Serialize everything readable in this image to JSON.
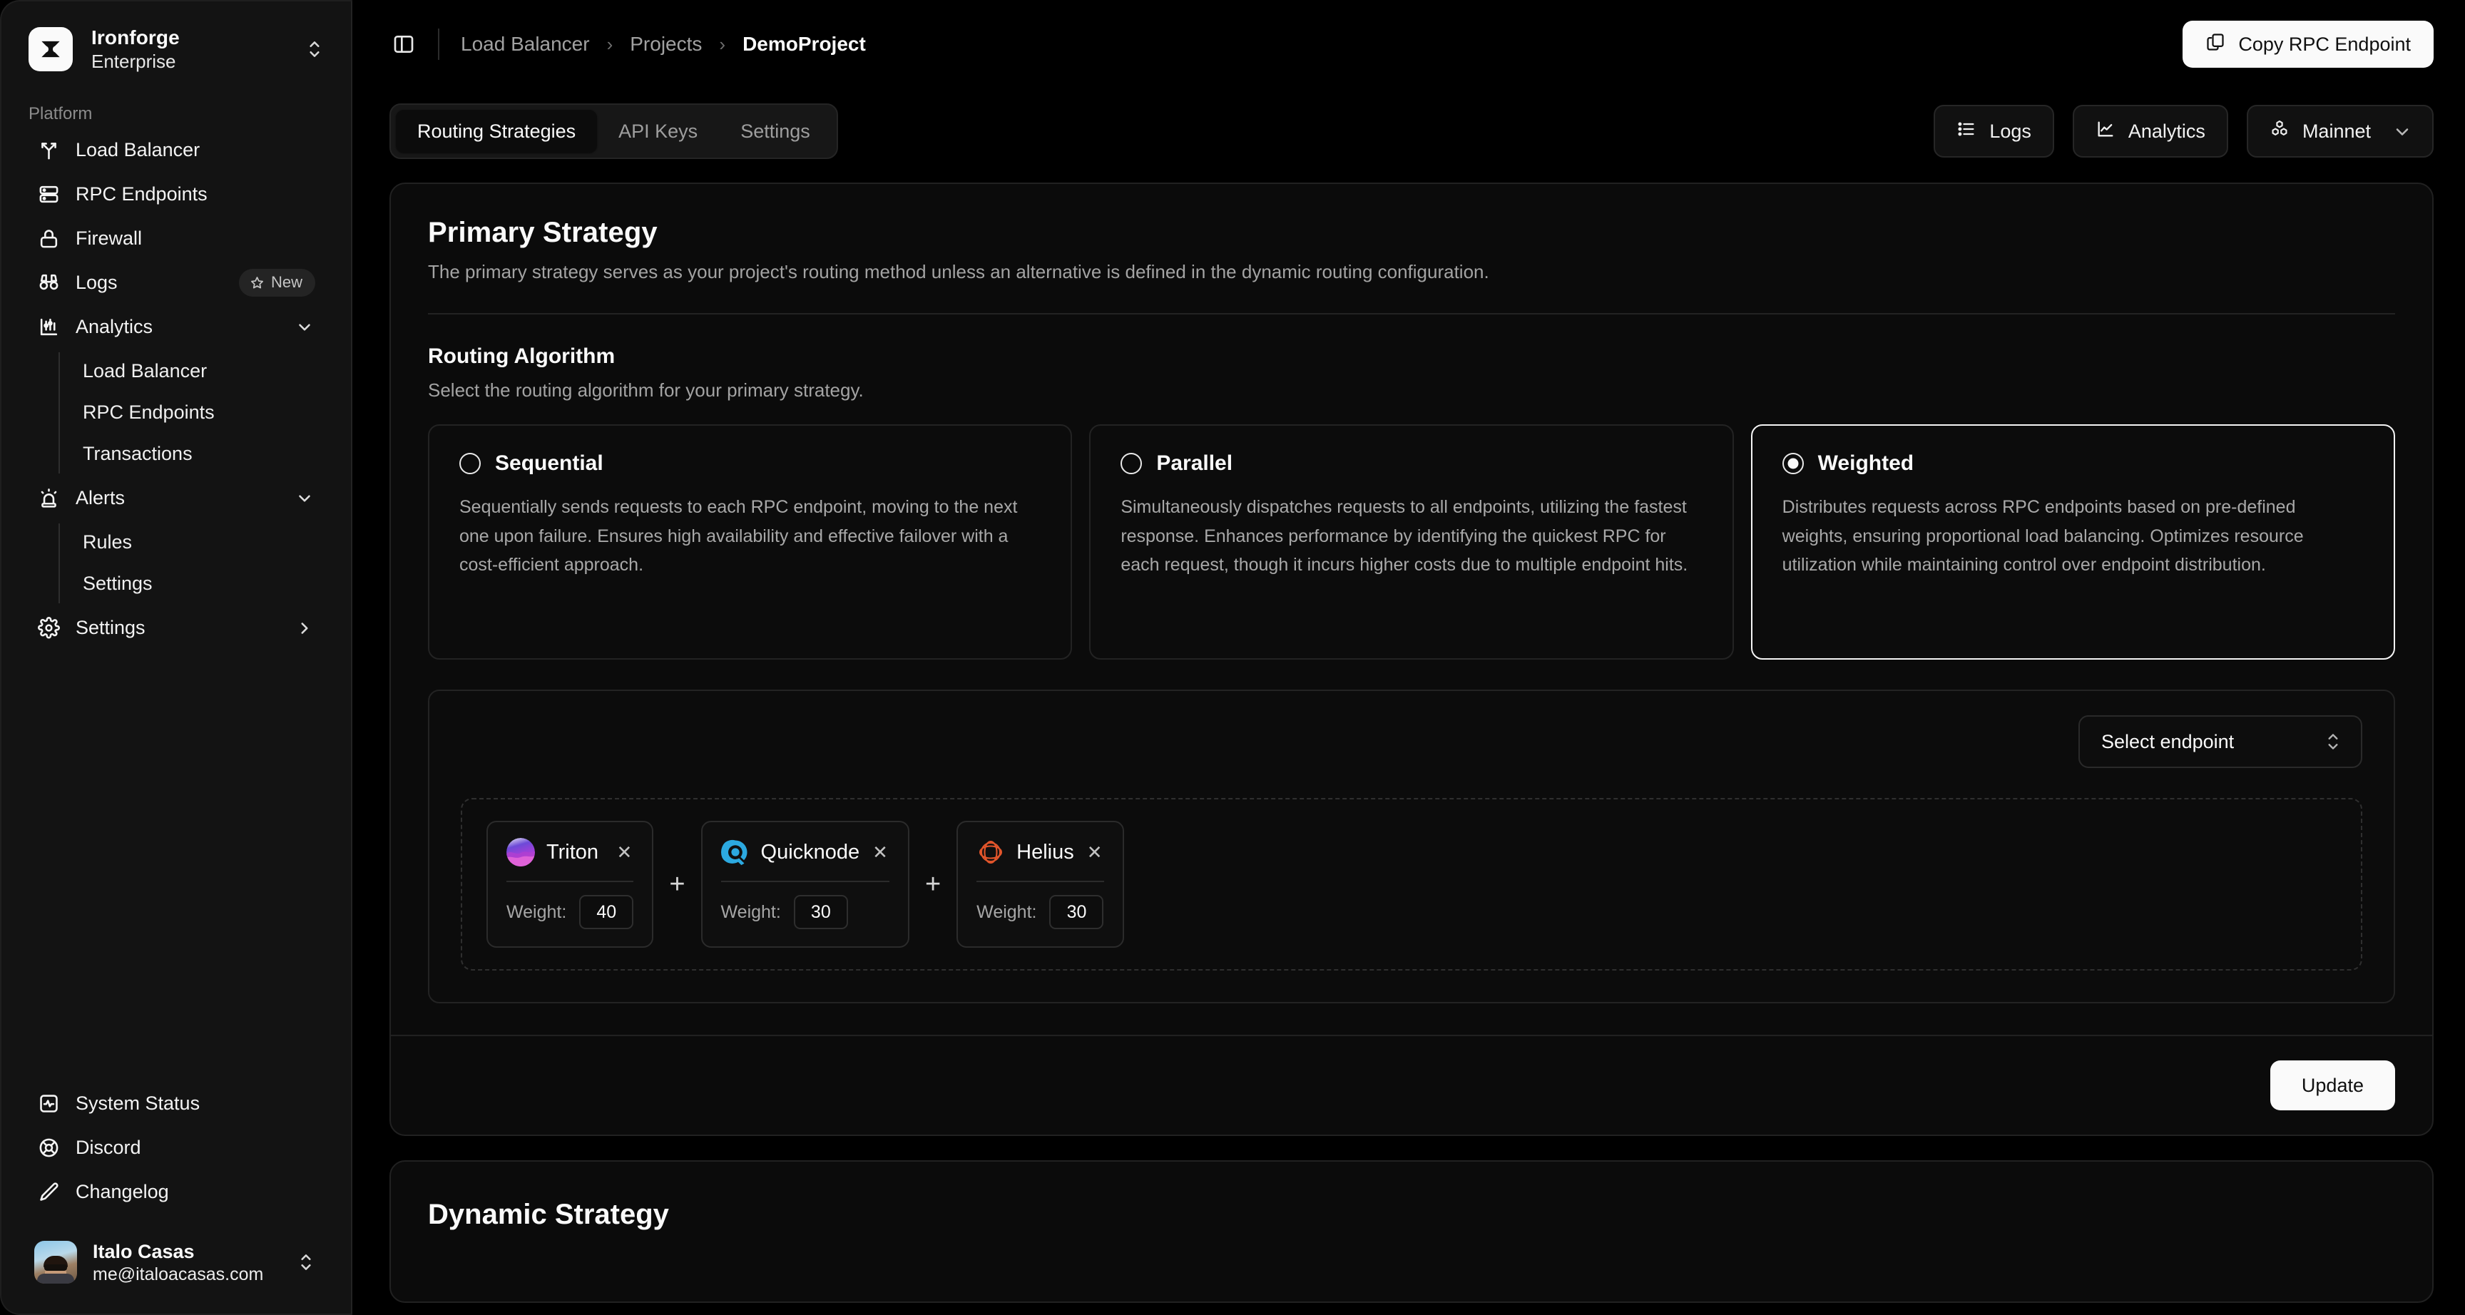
{
  "sidebar": {
    "org_name": "Ironforge",
    "org_plan": "Enterprise",
    "section_label": "Platform",
    "items": [
      {
        "label": "Load Balancer",
        "icon": "split-branch-icon"
      },
      {
        "label": "RPC Endpoints",
        "icon": "server-icon"
      },
      {
        "label": "Firewall",
        "icon": "lock-icon"
      },
      {
        "label": "Logs",
        "icon": "binoculars-icon",
        "badge": "New"
      },
      {
        "label": "Analytics",
        "icon": "analytics-icon",
        "chevron": "chevron-down-icon"
      },
      {
        "label": "Alerts",
        "icon": "siren-icon",
        "chevron": "chevron-down-icon"
      },
      {
        "label": "Settings",
        "icon": "gear-icon",
        "chevron": "chevron-right-icon"
      }
    ],
    "analytics_children": [
      "Load Balancer",
      "RPC Endpoints",
      "Transactions"
    ],
    "alerts_children": [
      "Rules",
      "Settings"
    ],
    "footer_items": [
      {
        "label": "System Status",
        "icon": "activity-square-icon"
      },
      {
        "label": "Discord",
        "icon": "lifebuoy-icon"
      },
      {
        "label": "Changelog",
        "icon": "pencil-icon"
      }
    ],
    "user": {
      "name": "Italo Casas",
      "email": "me@italoacasas.com"
    }
  },
  "topbar": {
    "panel_toggle_icon": "panel-left-icon",
    "breadcrumbs": [
      "Load Balancer",
      "Projects",
      "DemoProject"
    ],
    "breadcrumb_separator": "›",
    "copy_button": {
      "label": "Copy RPC Endpoint",
      "icon": "copy-icon"
    }
  },
  "tabbar": {
    "tabs": [
      {
        "label": "Routing Strategies",
        "active": true
      },
      {
        "label": "API Keys",
        "active": false
      },
      {
        "label": "Settings",
        "active": false
      }
    ],
    "actions": [
      {
        "label": "Logs",
        "icon": "list-icon"
      },
      {
        "label": "Analytics",
        "icon": "line-chart-icon"
      },
      {
        "label": "Mainnet",
        "icon": "boxes-icon",
        "chevron": "chevron-down-icon"
      }
    ]
  },
  "primary": {
    "title": "Primary Strategy",
    "description": "The primary strategy serves as your project's routing method unless an alternative is defined in the dynamic routing configuration.",
    "algorithm_title": "Routing Algorithm",
    "algorithm_description": "Select the routing algorithm for your primary strategy.",
    "algorithms": [
      {
        "name": "Sequential",
        "selected": false,
        "description": "Sequentially sends requests to each RPC endpoint, moving to the next one upon failure. Ensures high availability and effective failover with a cost-efficient approach."
      },
      {
        "name": "Parallel",
        "selected": false,
        "description": "Simultaneously dispatches requests to all endpoints, utilizing the fastest response. Enhances performance by identifying the quickest RPC for each request, though it incurs higher costs due to multiple endpoint hits."
      },
      {
        "name": "Weighted",
        "selected": true,
        "description": "Distributes requests across RPC endpoints based on pre-defined weights, ensuring proportional load balancing. Optimizes resource utilization while maintaining control over endpoint distribution."
      }
    ],
    "select_endpoint_placeholder": "Select endpoint",
    "weight_label": "Weight:",
    "remove_symbol": "✕",
    "plus_symbol": "+",
    "endpoints": [
      {
        "name": "Triton",
        "weight": "40",
        "logo": "triton-logo-icon",
        "color": "#8b5cf6"
      },
      {
        "name": "Quicknode",
        "weight": "30",
        "logo": "quicknode-logo-icon",
        "color": "#2ca9e0"
      },
      {
        "name": "Helius",
        "weight": "30",
        "logo": "helius-logo-icon",
        "color": "#e2552b"
      }
    ],
    "update_button": "Update"
  },
  "dynamic": {
    "title": "Dynamic Strategy"
  },
  "colors": {
    "page_bg": "#000000",
    "sidebar_bg": "#131313",
    "card_bg": "#0b0b0b",
    "accent_white": "#fafafa",
    "border": "#232323",
    "muted_text": "#a3a3a3"
  }
}
